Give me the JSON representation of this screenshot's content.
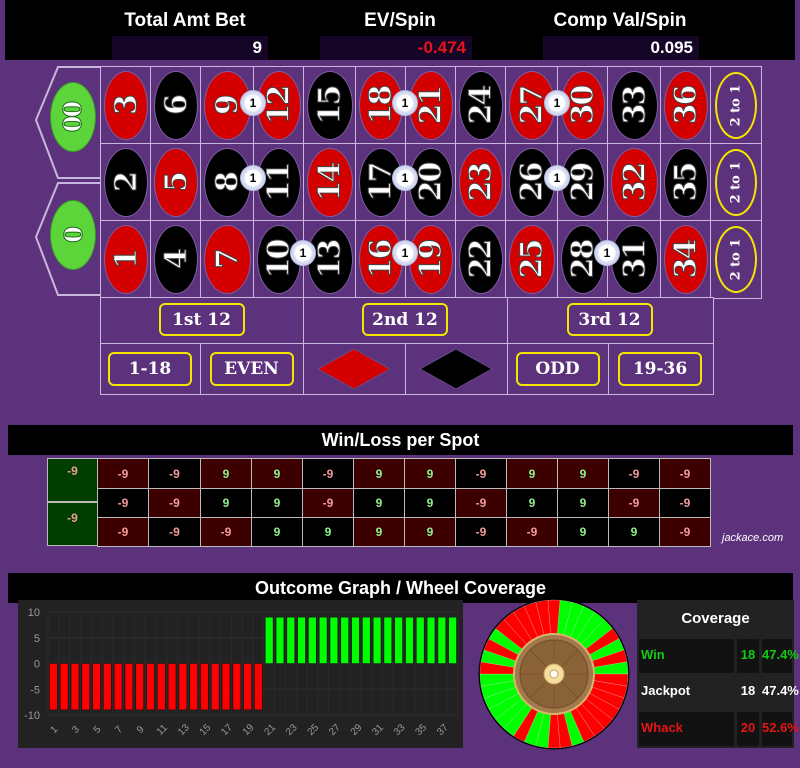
{
  "stats": {
    "total_amt_bet_label": "Total Amt Bet",
    "total_amt_bet_value": "9",
    "ev_spin_label": "EV/Spin",
    "ev_spin_value": "-0.474",
    "comp_val_label": "Comp Val/Spin",
    "comp_val_value": "0.095",
    "ev_color": "#e8141b"
  },
  "table": {
    "zeros": [
      {
        "label": "00",
        "color": "green"
      },
      {
        "label": "0",
        "color": "green"
      }
    ],
    "rows": [
      [
        {
          "n": "3",
          "c": "red"
        },
        {
          "n": "6",
          "c": "black"
        },
        {
          "n": "9",
          "c": "red"
        },
        {
          "n": "12",
          "c": "red"
        },
        {
          "n": "15",
          "c": "black"
        },
        {
          "n": "18",
          "c": "red"
        },
        {
          "n": "21",
          "c": "red"
        },
        {
          "n": "24",
          "c": "black"
        },
        {
          "n": "27",
          "c": "red"
        },
        {
          "n": "30",
          "c": "red"
        },
        {
          "n": "33",
          "c": "black"
        },
        {
          "n": "36",
          "c": "red"
        }
      ],
      [
        {
          "n": "2",
          "c": "black"
        },
        {
          "n": "5",
          "c": "red"
        },
        {
          "n": "8",
          "c": "black"
        },
        {
          "n": "11",
          "c": "black"
        },
        {
          "n": "14",
          "c": "red"
        },
        {
          "n": "17",
          "c": "black"
        },
        {
          "n": "20",
          "c": "black"
        },
        {
          "n": "23",
          "c": "red"
        },
        {
          "n": "26",
          "c": "black"
        },
        {
          "n": "29",
          "c": "black"
        },
        {
          "n": "32",
          "c": "red"
        },
        {
          "n": "35",
          "c": "black"
        }
      ],
      [
        {
          "n": "1",
          "c": "red"
        },
        {
          "n": "4",
          "c": "black"
        },
        {
          "n": "7",
          "c": "red"
        },
        {
          "n": "10",
          "c": "black"
        },
        {
          "n": "13",
          "c": "black"
        },
        {
          "n": "16",
          "c": "red"
        },
        {
          "n": "19",
          "c": "red"
        },
        {
          "n": "22",
          "c": "black"
        },
        {
          "n": "25",
          "c": "red"
        },
        {
          "n": "28",
          "c": "black"
        },
        {
          "n": "31",
          "c": "black"
        },
        {
          "n": "34",
          "c": "red"
        }
      ]
    ],
    "column_bets": [
      "2 to 1",
      "2 to 1",
      "2 to 1"
    ],
    "dozens": [
      "1st 12",
      "2nd 12",
      "3rd 12"
    ],
    "outside": {
      "low": "1-18",
      "even": "EVEN",
      "red": "red-diamond",
      "black": "black-diamond",
      "odd": "ODD",
      "high": "19-36"
    },
    "chips": [
      {
        "split": "9/12",
        "amount": "1",
        "row": 0,
        "col": 3
      },
      {
        "split": "18/21",
        "amount": "1",
        "row": 0,
        "col": 6
      },
      {
        "split": "27/30",
        "amount": "1",
        "row": 0,
        "col": 9
      },
      {
        "split": "8/11",
        "amount": "1",
        "row": 1,
        "col": 3
      },
      {
        "split": "17/20",
        "amount": "1",
        "row": 1,
        "col": 6
      },
      {
        "split": "26/29",
        "amount": "1",
        "row": 1,
        "col": 9
      },
      {
        "split": "10/13",
        "amount": "1",
        "row": 2,
        "col": 4
      },
      {
        "split": "16/19",
        "amount": "1",
        "row": 2,
        "col": 6
      },
      {
        "split": "28/31",
        "amount": "1",
        "row": 2,
        "col": 10
      }
    ]
  },
  "winloss": {
    "title": "Win/Loss per Spot",
    "zeros": [
      {
        "label": "00",
        "value": "-9"
      },
      {
        "label": "0",
        "value": "-9"
      }
    ],
    "grid": [
      [
        {
          "v": "-9",
          "bg": "red"
        },
        {
          "v": "-9",
          "bg": "black"
        },
        {
          "v": "9",
          "bg": "red"
        },
        {
          "v": "9",
          "bg": "red"
        },
        {
          "v": "-9",
          "bg": "black"
        },
        {
          "v": "9",
          "bg": "red"
        },
        {
          "v": "9",
          "bg": "red"
        },
        {
          "v": "-9",
          "bg": "black"
        },
        {
          "v": "9",
          "bg": "red"
        },
        {
          "v": "9",
          "bg": "red"
        },
        {
          "v": "-9",
          "bg": "black"
        },
        {
          "v": "-9",
          "bg": "red"
        }
      ],
      [
        {
          "v": "-9",
          "bg": "black"
        },
        {
          "v": "-9",
          "bg": "red"
        },
        {
          "v": "9",
          "bg": "black"
        },
        {
          "v": "9",
          "bg": "black"
        },
        {
          "v": "-9",
          "bg": "red"
        },
        {
          "v": "9",
          "bg": "black"
        },
        {
          "v": "9",
          "bg": "black"
        },
        {
          "v": "-9",
          "bg": "red"
        },
        {
          "v": "9",
          "bg": "black"
        },
        {
          "v": "9",
          "bg": "black"
        },
        {
          "v": "-9",
          "bg": "red"
        },
        {
          "v": "-9",
          "bg": "black"
        }
      ],
      [
        {
          "v": "-9",
          "bg": "red"
        },
        {
          "v": "-9",
          "bg": "black"
        },
        {
          "v": "-9",
          "bg": "red"
        },
        {
          "v": "9",
          "bg": "black"
        },
        {
          "v": "9",
          "bg": "black"
        },
        {
          "v": "9",
          "bg": "red"
        },
        {
          "v": "9",
          "bg": "red"
        },
        {
          "v": "-9",
          "bg": "black"
        },
        {
          "v": "-9",
          "bg": "red"
        },
        {
          "v": "9",
          "bg": "black"
        },
        {
          "v": "9",
          "bg": "black"
        },
        {
          "v": "-9",
          "bg": "red"
        }
      ]
    ],
    "credit": "jackace.com"
  },
  "outcome": {
    "title": "Outcome Graph / Wheel Coverage"
  },
  "chart_data": {
    "type": "bar",
    "title": "Outcome Graph",
    "xlabel": "",
    "ylabel": "",
    "ylim": [
      -10,
      10
    ],
    "yticks": [
      10,
      5,
      0,
      -5,
      -10
    ],
    "xticks": [
      1,
      3,
      5,
      7,
      9,
      11,
      13,
      15,
      17,
      19,
      21,
      23,
      25,
      27,
      29,
      31,
      33,
      35,
      37
    ],
    "x": [
      1,
      2,
      3,
      4,
      5,
      6,
      7,
      8,
      9,
      10,
      11,
      12,
      13,
      14,
      15,
      16,
      17,
      18,
      19,
      20,
      21,
      22,
      23,
      24,
      25,
      26,
      27,
      28,
      29,
      30,
      31,
      32,
      33,
      34,
      35,
      36,
      37,
      38
    ],
    "values": [
      -9,
      -9,
      -9,
      -9,
      -9,
      -9,
      -9,
      -9,
      -9,
      -9,
      -9,
      -9,
      -9,
      -9,
      -9,
      -9,
      -9,
      -9,
      -9,
      -9,
      9,
      9,
      9,
      9,
      9,
      9,
      9,
      9,
      9,
      9,
      9,
      9,
      9,
      9,
      9,
      9,
      9,
      9
    ],
    "colors": {
      "negative": "#ff0000",
      "positive": "#00ff00"
    },
    "grid": true
  },
  "wheel": {
    "order": [
      "0",
      "28",
      "9",
      "26",
      "30",
      "11",
      "7",
      "20",
      "32",
      "17",
      "5",
      "22",
      "34",
      "15",
      "3",
      "24",
      "36",
      "13",
      "1",
      "00",
      "27",
      "10",
      "25",
      "29",
      "12",
      "8",
      "19",
      "31",
      "18",
      "6",
      "21",
      "33",
      "16",
      "4",
      "23",
      "35",
      "14",
      "2"
    ],
    "winning": [
      "9",
      "12",
      "8",
      "11",
      "10",
      "13",
      "18",
      "21",
      "17",
      "20",
      "16",
      "19",
      "27",
      "30",
      "26",
      "29",
      "28",
      "31"
    ],
    "win_color": "#00ff00",
    "lose_color": "#ff0000"
  },
  "coverage": {
    "title": "Coverage",
    "rows": [
      {
        "label": "Win",
        "count": "18",
        "pct": "47.4%",
        "color": "#14c814"
      },
      {
        "label": "Jackpot",
        "count": "18",
        "pct": "47.4%",
        "color": "#ffffff"
      },
      {
        "label": "Whack",
        "count": "20",
        "pct": "52.6%",
        "color": "#e61414"
      }
    ]
  }
}
